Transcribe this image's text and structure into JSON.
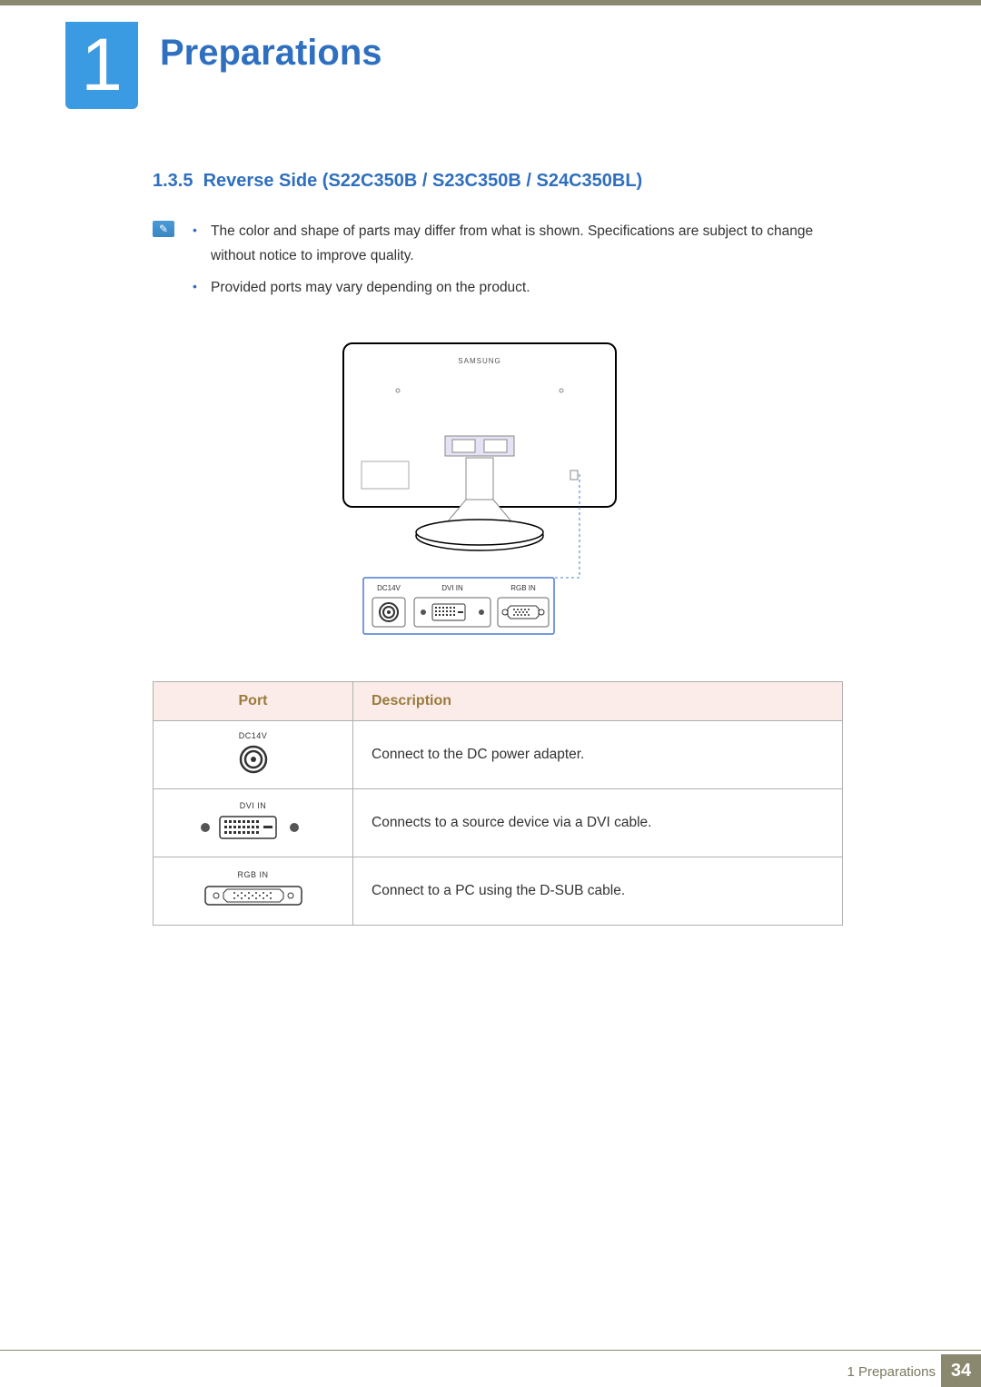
{
  "chapter": {
    "number": "1",
    "title": "Preparations"
  },
  "section": {
    "number": "1.3.5",
    "title": "Reverse Side (S22C350B / S23C350B / S24C350BL)"
  },
  "notes": [
    "The color and shape of parts may differ from what is shown. Specifications are subject to change without notice to improve quality.",
    "Provided ports may vary depending on the product."
  ],
  "figure": {
    "brand": "SAMSUNG",
    "ports": [
      "DC14V",
      "DVI IN",
      "RGB IN"
    ]
  },
  "table": {
    "headers": {
      "port": "Port",
      "description": "Description"
    },
    "rows": [
      {
        "label": "DC14V",
        "description": "Connect to the DC power adapter."
      },
      {
        "label": "DVI IN",
        "description": "Connects to a source device via a DVI cable."
      },
      {
        "label": "RGB IN",
        "description": "Connect to a PC using the D-SUB cable."
      }
    ]
  },
  "footer": {
    "chapter_ref": "1 Preparations",
    "page": "34"
  }
}
